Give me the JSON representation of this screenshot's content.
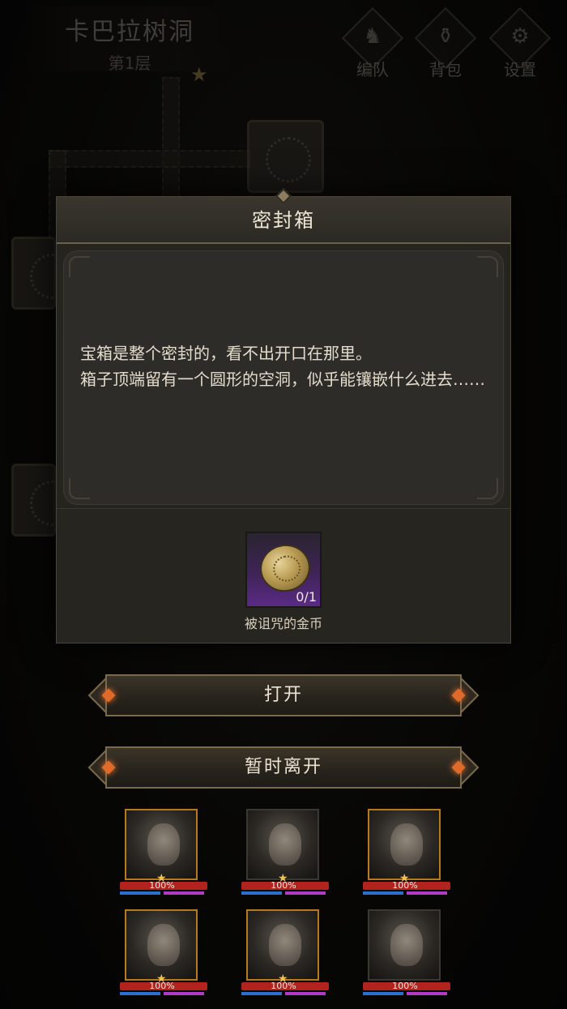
{
  "location": {
    "dungeon_name": "卡巴拉树洞",
    "floor": "第1层"
  },
  "top_menu": [
    {
      "label": "编队",
      "icon": "helmet-icon"
    },
    {
      "label": "背包",
      "icon": "bag-icon"
    },
    {
      "label": "设置",
      "icon": "gear-icon"
    }
  ],
  "dialog": {
    "title": "密封箱",
    "text": "宝箱是整个密封的，看不出开口在那里。\n箱子顶端留有一个圆形的空洞，似乎能镶嵌什么进去……",
    "item": {
      "name": "被诅咒的金币",
      "count": "0/1",
      "icon": "cursed-coin-icon"
    }
  },
  "actions": {
    "open_label": "打开",
    "leave_label": "暂时离开"
  },
  "party": [
    {
      "hp": "100%"
    },
    {
      "hp": "100%"
    },
    {
      "hp": "100%"
    },
    {
      "hp": "100%"
    },
    {
      "hp": "100%"
    },
    {
      "hp": "100%"
    }
  ],
  "colors": {
    "accent": "#e06a2a",
    "border_gold": "#7b6a4a",
    "hp_red": "#b3231d",
    "mp_blue": "#2b6fcf",
    "sp_purple": "#b13ac7",
    "item_rarity_purple": "#5a2a85"
  }
}
